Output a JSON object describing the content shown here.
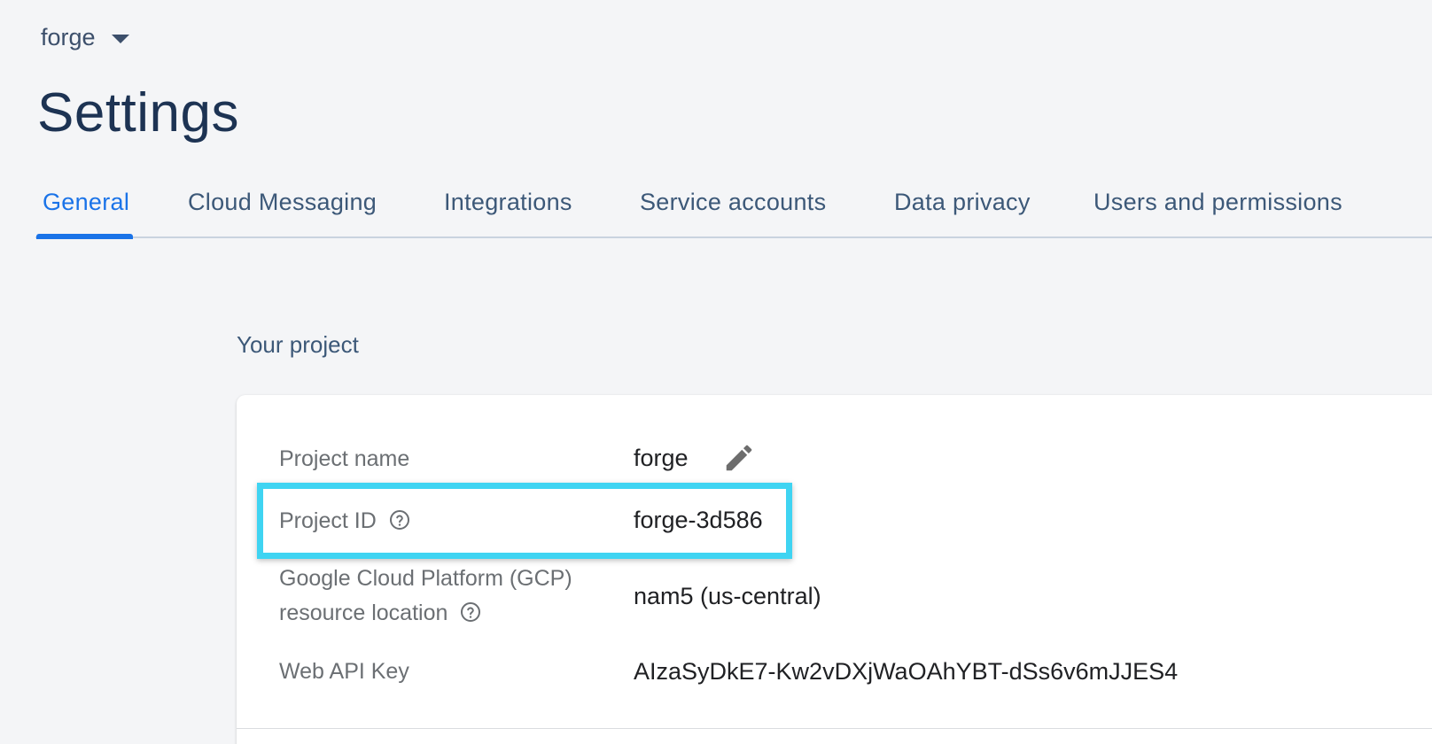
{
  "project_switcher": {
    "name": "forge",
    "icon": "caret-down-icon"
  },
  "page": {
    "title": "Settings"
  },
  "tabs": [
    {
      "label": "General",
      "active": true
    },
    {
      "label": "Cloud Messaging",
      "active": false
    },
    {
      "label": "Integrations",
      "active": false
    },
    {
      "label": "Service accounts",
      "active": false
    },
    {
      "label": "Data privacy",
      "active": false
    },
    {
      "label": "Users and permissions",
      "active": false
    }
  ],
  "section": {
    "label": "Your project"
  },
  "project": {
    "name_label": "Project name",
    "name_value": "forge",
    "id_label": "Project ID",
    "id_value": "forge-3d586",
    "gcp_label_line1": "Google Cloud Platform (GCP)",
    "gcp_label_line2": "resource location",
    "gcp_value": "nam5 (us-central)",
    "api_key_label": "Web API Key",
    "api_key_value": "AIzaSyDkE7-Kw2vDXjWaOAhYBT-dSs6v6mJJES4"
  },
  "colors": {
    "accent": "#1a73e8",
    "title": "#1d3353",
    "highlight": "#3fd4f2",
    "background": "#f4f5f7"
  }
}
